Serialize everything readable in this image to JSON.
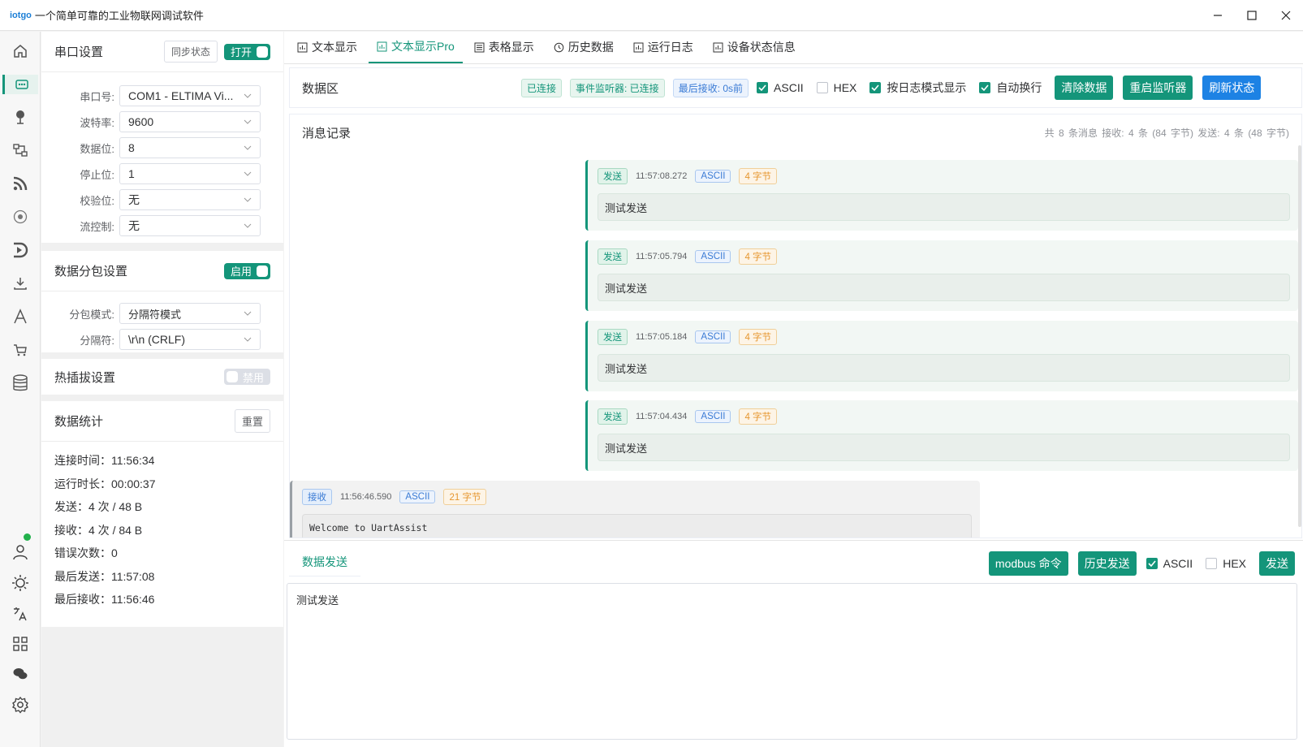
{
  "window": {
    "logo": "iotgo",
    "title": "一个简单可靠的工业物联网调试软件"
  },
  "icons": {
    "nav": [
      "home-icon",
      "serial-port-icon",
      "mqtt-icon",
      "network-icon",
      "rss-icon",
      "target-icon",
      "play-icon",
      "download-icon",
      "font-icon",
      "cart-icon",
      "database-icon"
    ],
    "nav_bottom": [
      "user-icon",
      "theme-icon",
      "translate-icon",
      "apps-icon",
      "chat-icon",
      "settings-icon"
    ],
    "status_dot_color": "#22b14c"
  },
  "serial": {
    "title": "串口设置",
    "sync_label": "同步状态",
    "open_label": "打开",
    "fields": [
      {
        "label": "串口号:",
        "value": "COM1 - ELTIMA Vi..."
      },
      {
        "label": "波特率:",
        "value": "9600"
      },
      {
        "label": "数据位:",
        "value": "8"
      },
      {
        "label": "停止位:",
        "value": "1"
      },
      {
        "label": "校验位:",
        "value": "无"
      },
      {
        "label": "流控制:",
        "value": "无"
      }
    ]
  },
  "packet": {
    "title": "数据分包设置",
    "switch_label": "启用",
    "fields": [
      {
        "label": "分包模式:",
        "value": "分隔符模式"
      },
      {
        "label": "分隔符:",
        "value": "\\r\\n (CRLF)"
      }
    ]
  },
  "hotplug": {
    "title": "热插拔设置",
    "switch_label": "禁用"
  },
  "stats": {
    "title": "数据统计",
    "reset_label": "重置",
    "lines": [
      "连接时间：11:56:34",
      "运行时长：00:00:37",
      "发送：4 次 / 48 B",
      "接收：4 次 / 84 B",
      "错误次数：0",
      "最后发送：11:57:08",
      "最后接收：11:56:46"
    ]
  },
  "tabs": [
    "文本显示",
    "文本显示Pro",
    "表格显示",
    "历史数据",
    "运行日志",
    "设备状态信息"
  ],
  "toolbar": {
    "title": "数据区",
    "tags": [
      "已连接",
      "事件监听器: 已连接",
      "最后接收: 0s前"
    ],
    "checks": [
      {
        "label": "ASCII",
        "checked": true
      },
      {
        "label": "HEX",
        "checked": false
      },
      {
        "label": "按日志模式显示",
        "checked": true
      },
      {
        "label": "自动换行",
        "checked": true
      }
    ],
    "buttons": [
      "清除数据",
      "重启监听器",
      "刷新状态"
    ]
  },
  "log": {
    "title": "消息记录",
    "summary": "共 8 条消息  接收: 4 条 (84 字节)  发送: 4 条 (48 字节)",
    "messages": [
      {
        "dir": "发送",
        "time": "11:57:08.272",
        "fmt": "ASCII",
        "size": "4 字节",
        "body": "测试发送"
      },
      {
        "dir": "发送",
        "time": "11:57:05.794",
        "fmt": "ASCII",
        "size": "4 字节",
        "body": "测试发送"
      },
      {
        "dir": "发送",
        "time": "11:57:05.184",
        "fmt": "ASCII",
        "size": "4 字节",
        "body": "测试发送"
      },
      {
        "dir": "发送",
        "time": "11:57:04.434",
        "fmt": "ASCII",
        "size": "4 字节",
        "body": "测试发送"
      },
      {
        "dir": "接收",
        "time": "11:56:46.590",
        "fmt": "ASCII",
        "size": "21 字节",
        "body": "Welcome to UartAssist"
      }
    ]
  },
  "send": {
    "tab": "数据发送",
    "modbus_label": "modbus 命令",
    "history_label": "历史发送",
    "ascii_label": "ASCII",
    "ascii_checked": true,
    "hex_label": "HEX",
    "hex_checked": false,
    "send_label": "发送",
    "text": "测试发送"
  }
}
